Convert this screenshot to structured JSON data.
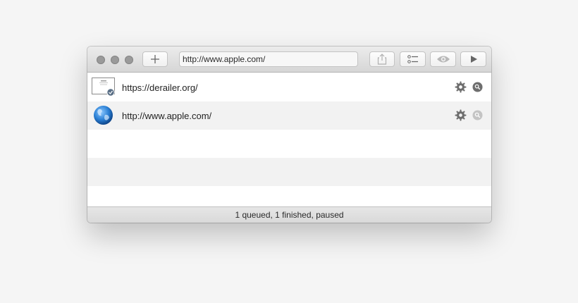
{
  "toolbar": {
    "url_value": "http://www.apple.com/",
    "add_icon": "plus-icon",
    "share_icon": "share-icon",
    "list_icon": "list-icon",
    "eye_icon": "eye-icon",
    "play_icon": "play-icon"
  },
  "items": [
    {
      "label": "https://derailer.org/",
      "thumb_icon": "page-thumbnail-icon",
      "status": "finished"
    },
    {
      "label": "http://www.apple.com/",
      "thumb_icon": "globe-icon",
      "status": "queued"
    }
  ],
  "status": {
    "text": "1 queued, 1 finished, paused"
  },
  "colors": {
    "icon": "#6e6e6e",
    "icon_disabled": "#b8b8b8",
    "globe": "#2a7fd4"
  }
}
